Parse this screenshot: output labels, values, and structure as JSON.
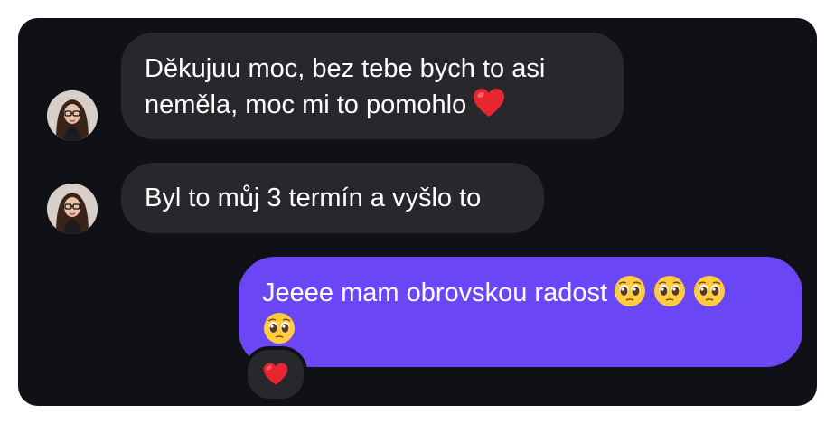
{
  "conversation": {
    "messages": [
      {
        "direction": "incoming",
        "lines": [
          "Děkujuu moc, bez tebe bych to asi",
          "neměla, moc mi to pomohlo"
        ],
        "emoji": "red-heart"
      },
      {
        "direction": "incoming",
        "lines": [
          "Byl to můj 3 termín a vyšlo to"
        ]
      },
      {
        "direction": "outgoing",
        "lines": [
          "Jeeee mam obrovskou radost"
        ],
        "emoji": [
          "pleading-face",
          "pleading-face",
          "pleading-face",
          "pleading-face"
        ],
        "reaction": "red-heart"
      }
    ]
  },
  "colors": {
    "background": "#0f1116",
    "incoming_bubble": "#26282c",
    "outgoing_bubble": "#6b46f6",
    "text": "#ffffff"
  }
}
